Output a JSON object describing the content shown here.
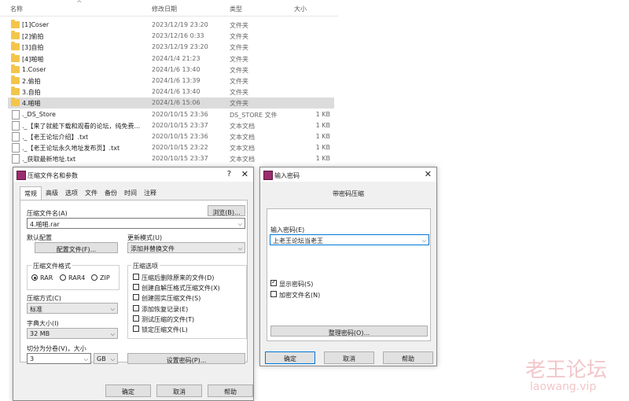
{
  "explorer": {
    "columns": {
      "name": "名称",
      "date": "修改日期",
      "type": "类型",
      "size": "大小"
    },
    "rows": [
      {
        "name": "[1]Coser",
        "date": "2023/12/19 23:20",
        "type": "文件夹",
        "size": "",
        "icon": "folder-icon"
      },
      {
        "name": "[2]偷拍",
        "date": "2023/12/16 0:33",
        "type": "文件夹",
        "size": "",
        "icon": "folder-icon"
      },
      {
        "name": "[3]自拍",
        "date": "2023/12/19 23:20",
        "type": "文件夹",
        "size": "",
        "icon": "folder-icon"
      },
      {
        "name": "[4]啪啪",
        "date": "2024/1/4 21:23",
        "type": "文件夹",
        "size": "",
        "icon": "folder-icon"
      },
      {
        "name": "1.Coser",
        "date": "2024/1/6 13:40",
        "type": "文件夹",
        "size": "",
        "icon": "folder-icon"
      },
      {
        "name": "2.偷拍",
        "date": "2024/1/6 13:39",
        "type": "文件夹",
        "size": "",
        "icon": "folder-icon"
      },
      {
        "name": "3.自拍",
        "date": "2024/1/6 13:40",
        "type": "文件夹",
        "size": "",
        "icon": "folder-icon"
      },
      {
        "name": "4.啪啪",
        "date": "2024/1/6 15:06",
        "type": "文件夹",
        "size": "",
        "icon": "folder-icon",
        "selected": true
      },
      {
        "name": "._DS_Store",
        "date": "2020/10/15 23:36",
        "type": "DS_STORE 文件",
        "size": "1 KB",
        "icon": "file-icon"
      },
      {
        "name": "._【来了就能下载和观看的论坛，纯免费...",
        "date": "2020/10/15 23:37",
        "type": "文本文档",
        "size": "1 KB",
        "icon": "text-file-icon"
      },
      {
        "name": "._【老王论坛介绍】.txt",
        "date": "2020/10/15 23:36",
        "type": "文本文档",
        "size": "1 KB",
        "icon": "text-file-icon"
      },
      {
        "name": "._【老王论坛永久地址发布页】.txt",
        "date": "2020/10/15 23:22",
        "type": "文本文档",
        "size": "1 KB",
        "icon": "text-file-icon"
      },
      {
        "name": "._获取最新地址.txt",
        "date": "2020/10/15 23:37",
        "type": "文本文档",
        "size": "1 KB",
        "icon": "text-file-icon"
      }
    ]
  },
  "archive_dialog": {
    "title": "压缩文件名和参数",
    "help_glyph": "?",
    "close_glyph": "✕",
    "tabs": [
      "常规",
      "高级",
      "选项",
      "文件",
      "备份",
      "时间",
      "注释"
    ],
    "archive_name_label": "压缩文件名(A)",
    "browse_label": "浏览(B)...",
    "archive_name_value": "4.啪啪.rar",
    "default_config_label": "默认配置",
    "config_button": "配置文件(F)...",
    "update_mode_label": "更新模式(U)",
    "update_mode_value": "添加并替换文件",
    "format_group": "压缩文件格式",
    "formats": [
      "RAR",
      "RAR4",
      "ZIP"
    ],
    "selected_format": "RAR",
    "method_label": "压缩方式(C)",
    "method_value": "标准",
    "dict_label": "字典大小(I)",
    "dict_value": "32 MB",
    "split_label": "切分为分卷(V)，大小",
    "split_value": "3",
    "split_unit": "GB",
    "options_group": "压缩选项",
    "options": [
      {
        "label": "压缩后删除原来的文件(D)",
        "checked": false
      },
      {
        "label": "创建自解压格式压缩文件(X)",
        "checked": false
      },
      {
        "label": "创建固实压缩文件(S)",
        "checked": false
      },
      {
        "label": "添加恢复记录(E)",
        "checked": false
      },
      {
        "label": "测试压缩的文件(T)",
        "checked": false
      },
      {
        "label": "锁定压缩文件(L)",
        "checked": false
      }
    ],
    "set_password": "设置密码(P)...",
    "ok": "确定",
    "cancel": "取消",
    "help": "帮助"
  },
  "password_dialog": {
    "title": "输入密码",
    "close_glyph": "✕",
    "heading": "带密码压缩",
    "password_label": "输入密码(E)",
    "password_value": "上老王论坛当老王",
    "show_password": "显示密码(S)",
    "show_password_checked": true,
    "encrypt_names": "加密文件名(N)",
    "encrypt_names_checked": false,
    "organize": "整理密码(O)...",
    "ok": "确定",
    "cancel": "取消",
    "help": "帮助"
  },
  "watermark": {
    "line1": "老王论坛",
    "line2": "laowang.vip"
  }
}
